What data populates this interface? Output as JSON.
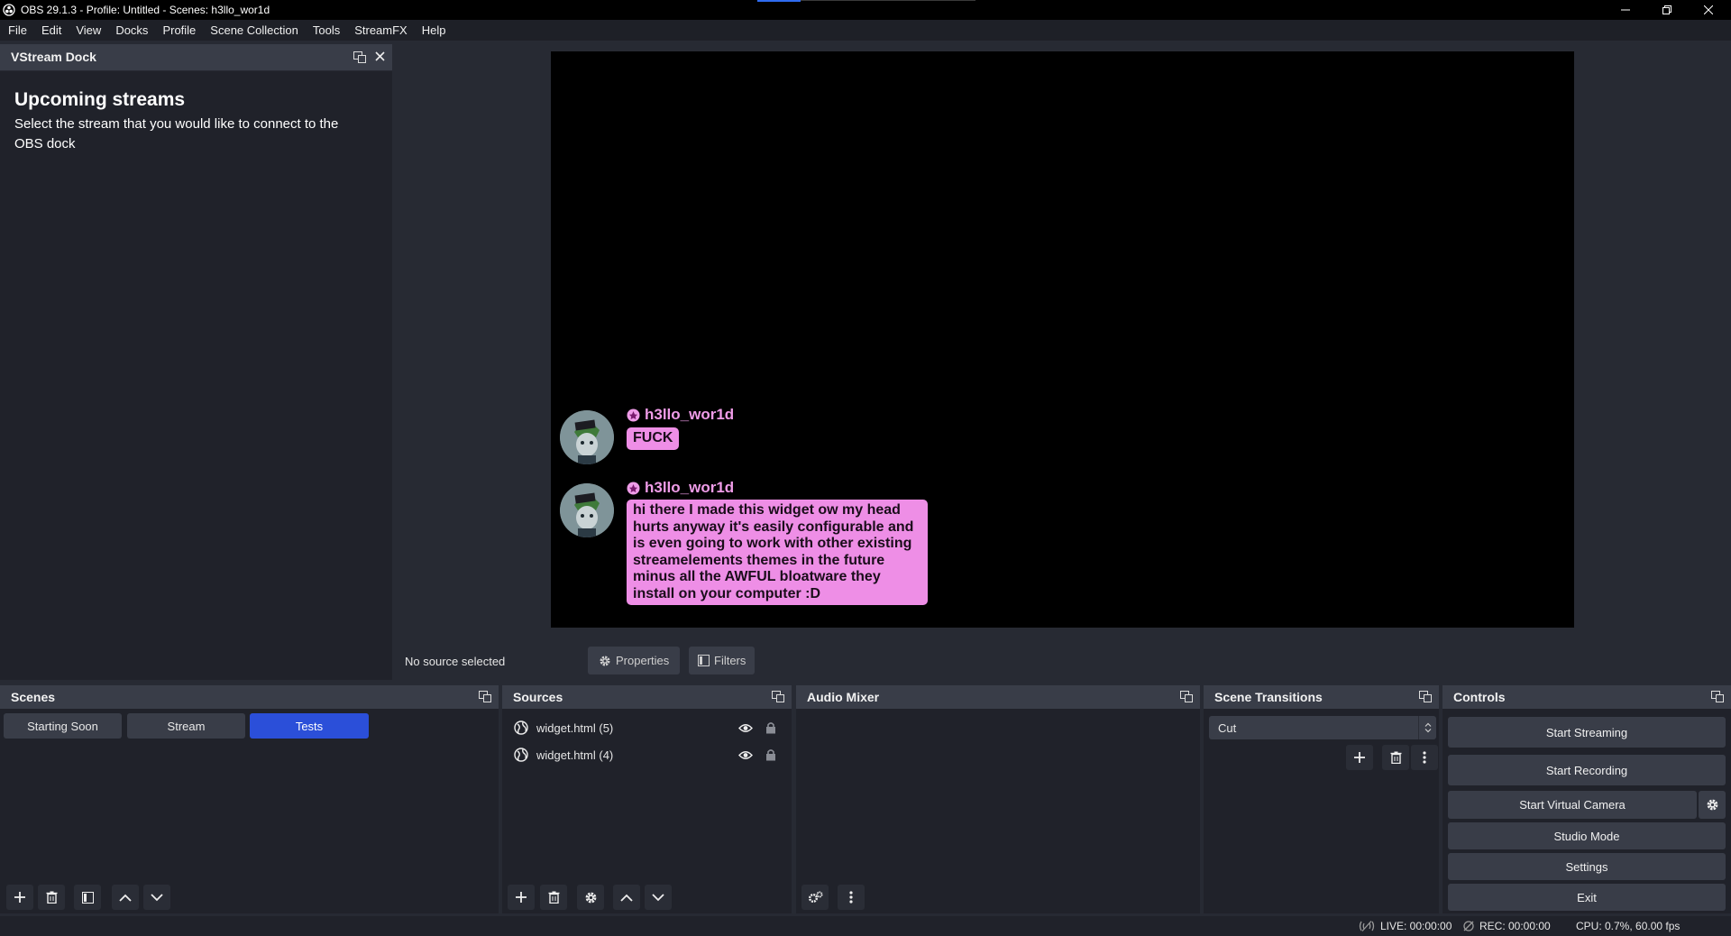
{
  "window": {
    "title": "OBS 29.1.3 - Profile: Untitled - Scenes: h3llo_wor1d"
  },
  "menu": [
    "File",
    "Edit",
    "View",
    "Docks",
    "Profile",
    "Scene Collection",
    "Tools",
    "StreamFX",
    "Help"
  ],
  "vstream_dock": {
    "title": "VStream Dock",
    "heading": "Upcoming streams",
    "description": "Select the stream that you would like to connect to the OBS dock"
  },
  "chat": {
    "messages": [
      {
        "user": "h3llo_wor1d",
        "text": "FUCK"
      },
      {
        "user": "h3llo_wor1d",
        "text": "hi there I made this widget ow my head hurts anyway it's easily configurable and is even going to work with other existing streamelements themes in the future minus all the AWFUL bloatware they install on your computer :D"
      }
    ],
    "name_color": "#ef9ce8",
    "bubble_color": "#ee8ee6"
  },
  "source_toolbar": {
    "status": "No source selected",
    "properties_label": "Properties",
    "filters_label": "Filters"
  },
  "scenes": {
    "title": "Scenes",
    "items": [
      "Starting Soon",
      "Stream",
      "Tests"
    ],
    "active_index": 2,
    "active_color": "#2b4fd9"
  },
  "sources": {
    "title": "Sources",
    "items": [
      "widget.html (5)",
      "widget.html (4)"
    ]
  },
  "audio_mixer": {
    "title": "Audio Mixer"
  },
  "transitions": {
    "title": "Scene Transitions",
    "selected": "Cut"
  },
  "controls": {
    "title": "Controls",
    "start_streaming": "Start Streaming",
    "start_recording": "Start Recording",
    "start_virtual_camera": "Start Virtual Camera",
    "studio_mode": "Studio Mode",
    "settings": "Settings",
    "exit": "Exit"
  },
  "status": {
    "live": "LIVE: 00:00:00",
    "rec": "REC: 00:00:00",
    "cpu": "CPU: 0.7%, 60.00 fps"
  }
}
